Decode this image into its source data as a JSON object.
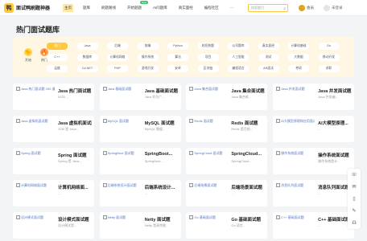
{
  "header": {
    "brand": "面试鸭刷题神器",
    "logo_glyph": "鸭",
    "nav": [
      {
        "label": "主页",
        "active": true
      },
      {
        "label": "题库"
      },
      {
        "label": "刷题路线"
      },
      {
        "label": "开始题题",
        "badge": "New"
      },
      {
        "label": "AI问题库"
      },
      {
        "label": "真实面经"
      },
      {
        "label": "编程社区"
      },
      {
        "label": "···"
      }
    ],
    "search_placeholder": "搜索题目",
    "search_icon": "search-icon",
    "vip_label": "会员",
    "user_label": "未登录"
  },
  "page_title": "热门面试题库",
  "quick": [
    {
      "label": "开始",
      "icon": "🐤",
      "color": "#ffd34d"
    },
    {
      "label": "热门",
      "icon": "🔥",
      "color": "#ff9a52"
    }
  ],
  "tags_rows": [
    [
      "热门",
      "Java",
      "后端",
      "前端",
      "Python",
      "校招热题",
      "公司题库",
      "真实面经",
      "计算机基础",
      "Go"
    ],
    [
      "C++",
      "数据库",
      "计算机网络",
      "操作系统",
      "算法",
      "项目",
      "人工智能",
      "测试",
      "大数据",
      "移动开发"
    ],
    [
      "运维",
      "C#.NET",
      "PHP",
      "游戏开发",
      "安卓",
      "区块链",
      "编程语言",
      "AR面试",
      "考研",
      "求职"
    ]
  ],
  "cards": [
    {
      "img": "Java 热门面试题 200 道",
      "title": "Java 热门面试题",
      "desc": "2025 ..."
    },
    {
      "img": "Java 基础面试题",
      "title": "Java 基础面试题",
      "desc": "Java 作为广..."
    },
    {
      "img": "Java 集合面试题",
      "title": "Java 集合面试题",
      "desc": "Java 集合框..."
    },
    {
      "img": "Java 并发面试题",
      "title": "Java 并发面试题",
      "desc": "Java 并发编..."
    },
    {
      "img": "Java 虚拟机面试题",
      "title": "Java 虚拟机面试题",
      "desc": "JVM 是 Java..."
    },
    {
      "img": "MySQL 面试题",
      "title": "MySQL 面试题",
      "desc": "MySQL 数据..."
    },
    {
      "img": "Redis 面试题",
      "title": "Redis 面试题",
      "desc": "Redis 是目前..."
    },
    {
      "img": "AI大模型原理和应用面试题",
      "title": "AI大模型原理...",
      "desc": "..."
    },
    {
      "img": "Spring 面试题",
      "title": "Spring 面试题",
      "desc": "Spring 是 Java..."
    },
    {
      "img": "SpringBoot 面试题",
      "title": "SpringBoot...",
      "desc": "SpringBoot..."
    },
    {
      "img": "SpringCloud 面试题",
      "title": "SpringCloud...",
      "desc": "SpringCloud..."
    },
    {
      "img": "操作系统面试题",
      "title": "操作系统面试题",
      "desc": "操作系统是计..."
    },
    {
      "img": "计算机网络面试题",
      "title": "计算机网络面...",
      "desc": "..."
    },
    {
      "img": "后端系统设计面试题",
      "title": "后端系统设计...",
      "desc": "..."
    },
    {
      "img": "后端场景面试题",
      "title": "后端场景面试题",
      "desc": "..."
    },
    {
      "img": "消息队列面试题",
      "title": "消息队列面试题",
      "desc": "..."
    },
    {
      "img": "设计模式面试题",
      "title": "设计模式面试题",
      "desc": "设计模式是..."
    },
    {
      "img": "Netty 面试题",
      "title": "Netty 面试题",
      "desc": "Netty 是高性能..."
    },
    {
      "img": "Go 基础面试题",
      "title": "Go 基础面试题",
      "desc": "Go 语言..."
    },
    {
      "img": "C++ 基础面试题",
      "title": "C++ 基础面试题",
      "desc": "..."
    }
  ],
  "float_icons": [
    "customer-service-icon",
    "wechat-icon",
    "bookmark-icon",
    "edit-icon",
    "headset-icon"
  ]
}
